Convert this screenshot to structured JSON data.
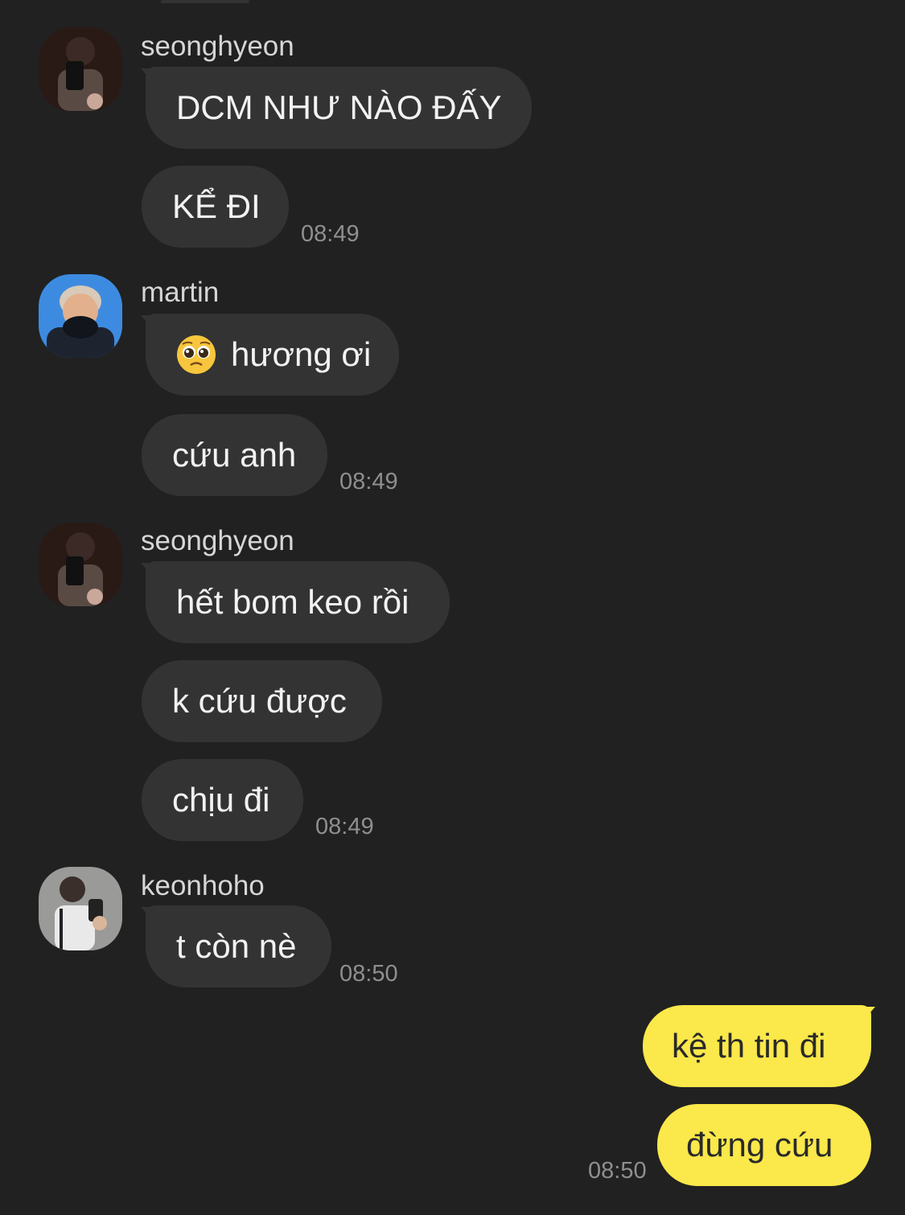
{
  "groups": [
    {
      "sender": "seonghyeon",
      "avatar_icon": "seonghyeon-avatar",
      "messages": [
        "DCM NHƯ NÀO ĐẤY",
        "KỂ ĐI"
      ],
      "time": "08:49"
    },
    {
      "sender": "martin",
      "avatar_icon": "martin-avatar",
      "messages": [
        "hương ơi",
        "cứu anh"
      ],
      "first_message_emoji": "pleading-face-emoji",
      "time": "08:49"
    },
    {
      "sender": "seonghyeon",
      "avatar_icon": "seonghyeon-avatar",
      "messages": [
        "hết bom keo rồi",
        "k cứu được",
        "chịu đi"
      ],
      "time": "08:49"
    },
    {
      "sender": "keonhoho",
      "avatar_icon": "keonhoho-avatar",
      "messages": [
        "t còn nè"
      ],
      "time": "08:50"
    }
  ],
  "outgoing": {
    "messages": [
      "kệ th tin đi",
      "đừng cứu"
    ],
    "time": "08:50"
  },
  "colors": {
    "background": "#212121",
    "incoming_bubble": "#333333",
    "outgoing_bubble": "#fbe84a"
  }
}
